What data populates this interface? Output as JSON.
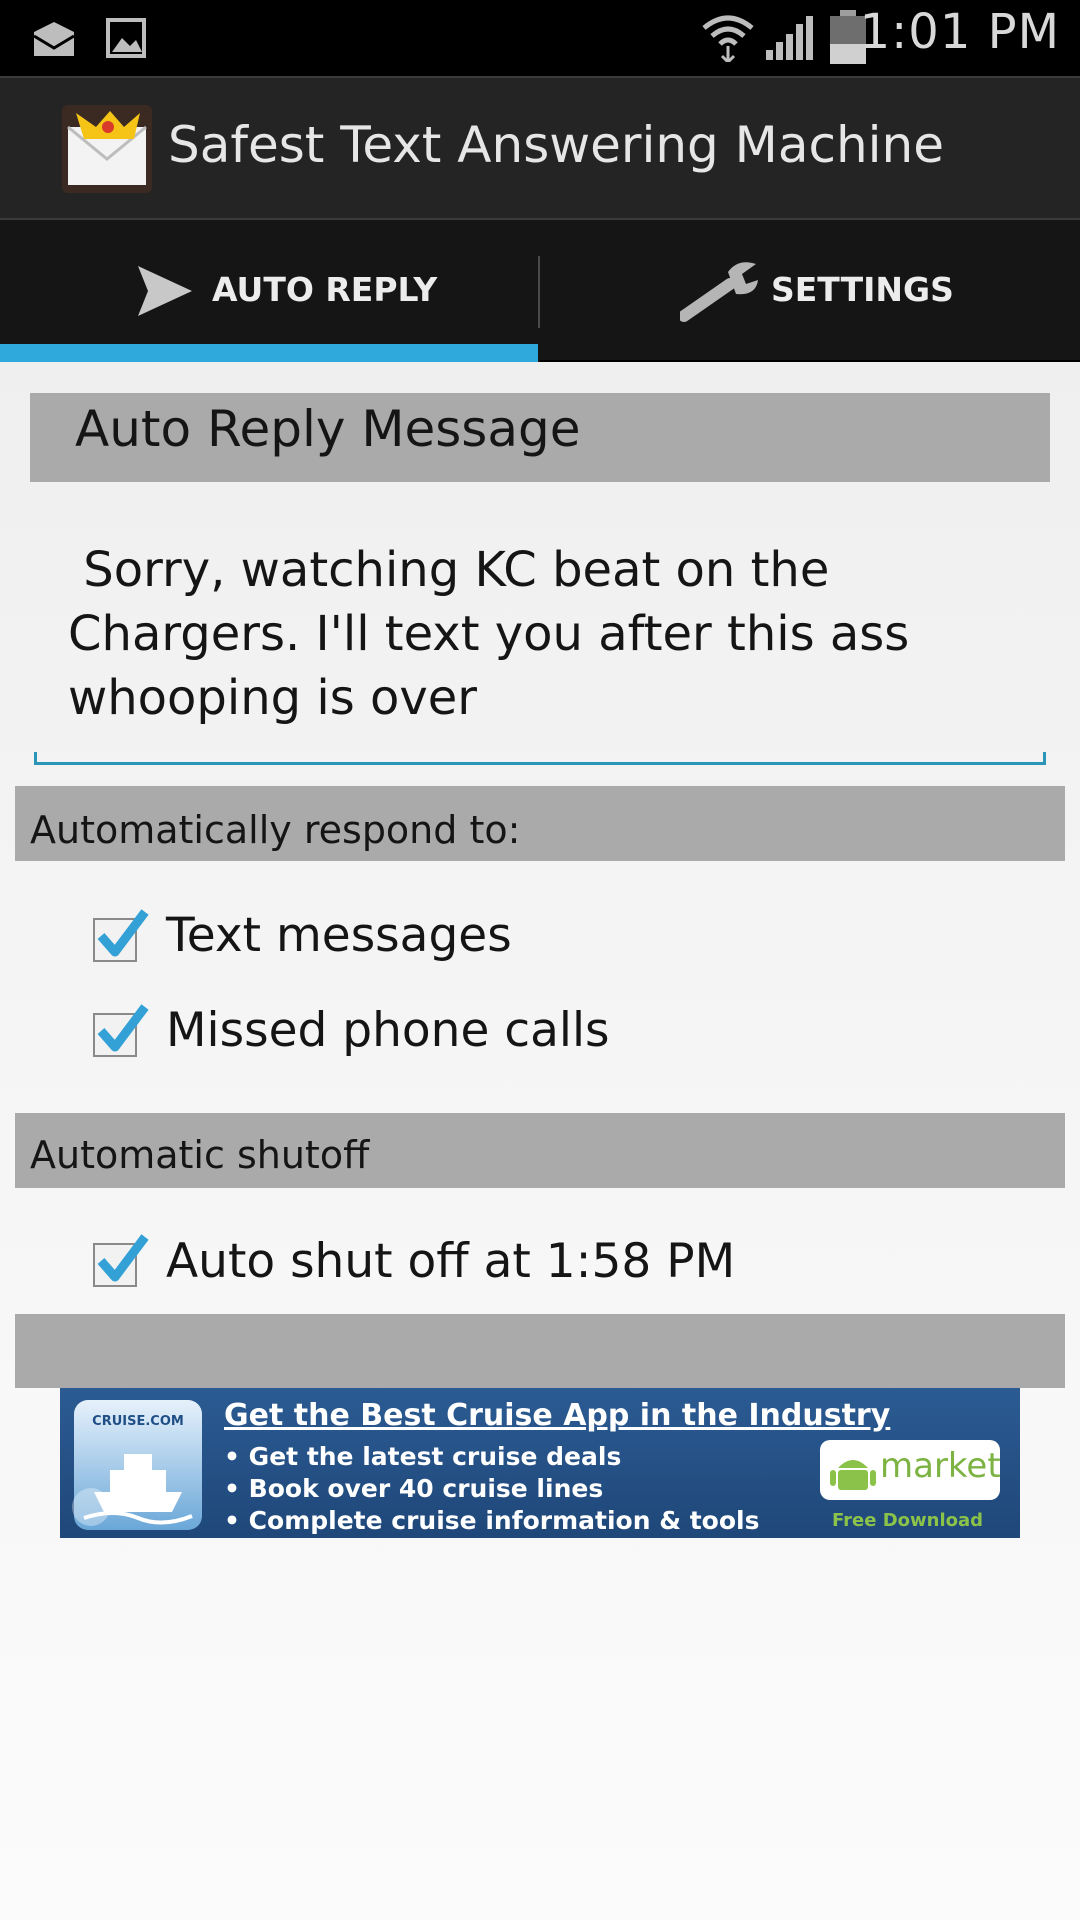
{
  "status_bar": {
    "time": "1:01 PM"
  },
  "app": {
    "title": "Safest Text Answering Machine"
  },
  "tabs": [
    {
      "label": "AUTO REPLY",
      "selected": true
    },
    {
      "label": "SETTINGS",
      "selected": false
    }
  ],
  "auto_reply": {
    "header": "Auto Reply Message",
    "message": " Sorry, watching KC beat on the Chargers. I'll text you after this ass whooping is over"
  },
  "respond_section": {
    "header": "Automatically respond to:",
    "options": [
      {
        "label": "Text messages",
        "checked": true
      },
      {
        "label": "Missed phone calls",
        "checked": true
      }
    ]
  },
  "shutoff_section": {
    "header": "Automatic shutoff",
    "options": [
      {
        "label": "Auto shut off at 1:58 PM",
        "checked": true
      }
    ]
  },
  "ad": {
    "brand": "CRUISE.COM",
    "title": "Get the Best Cruise App in the Industry",
    "bullets": [
      "• Get the latest cruise deals",
      "• Book over 40 cruise lines",
      "• Complete cruise information & tools"
    ],
    "store": "market",
    "cta": "Free Download"
  },
  "colors": {
    "accent": "#2fa8dc",
    "section_bar": "#aaaaaa",
    "checkbox_check": "#33a1d6"
  }
}
